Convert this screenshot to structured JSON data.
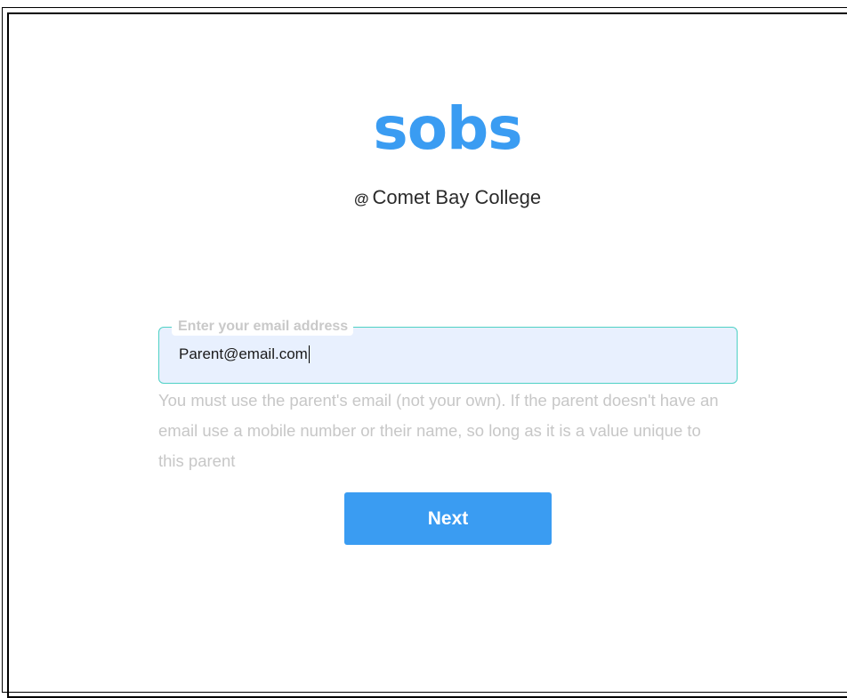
{
  "colors": {
    "brand": "#3a9cf2",
    "field_bg": "#e8f0fe",
    "field_border": "#4fd1c5",
    "button_bg": "#3a9cf2"
  },
  "branding": {
    "logo_text": "sobs",
    "at_symbol": "@",
    "school_name": "Comet Bay College"
  },
  "form": {
    "email_label": "Enter your email address",
    "email_value": "Parent@email.com",
    "help_text": "You must use the parent's email (not your own). If the parent doesn't have an email use a mobile number or their name, so long as it is a value unique to this parent",
    "next_label": "Next"
  }
}
